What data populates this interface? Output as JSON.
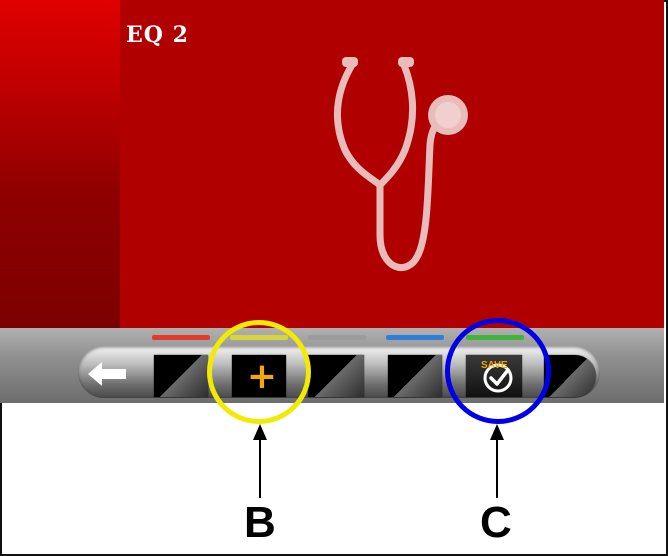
{
  "screen": {
    "title": "EQ 2",
    "illustration": "stethoscope-icon"
  },
  "toolbar": {
    "color_tabs": [
      "#e33a2e",
      "#d6d43a",
      "#9c9c9c",
      "#2f7fd6",
      "#3fb43f"
    ],
    "back_button": "back-arrow-icon",
    "add_button": "+",
    "save_button_text": "SAVE"
  },
  "annotations": {
    "b_label": "B",
    "c_label": "C",
    "b_color": "#f2ea00",
    "c_color": "#0000e6"
  }
}
